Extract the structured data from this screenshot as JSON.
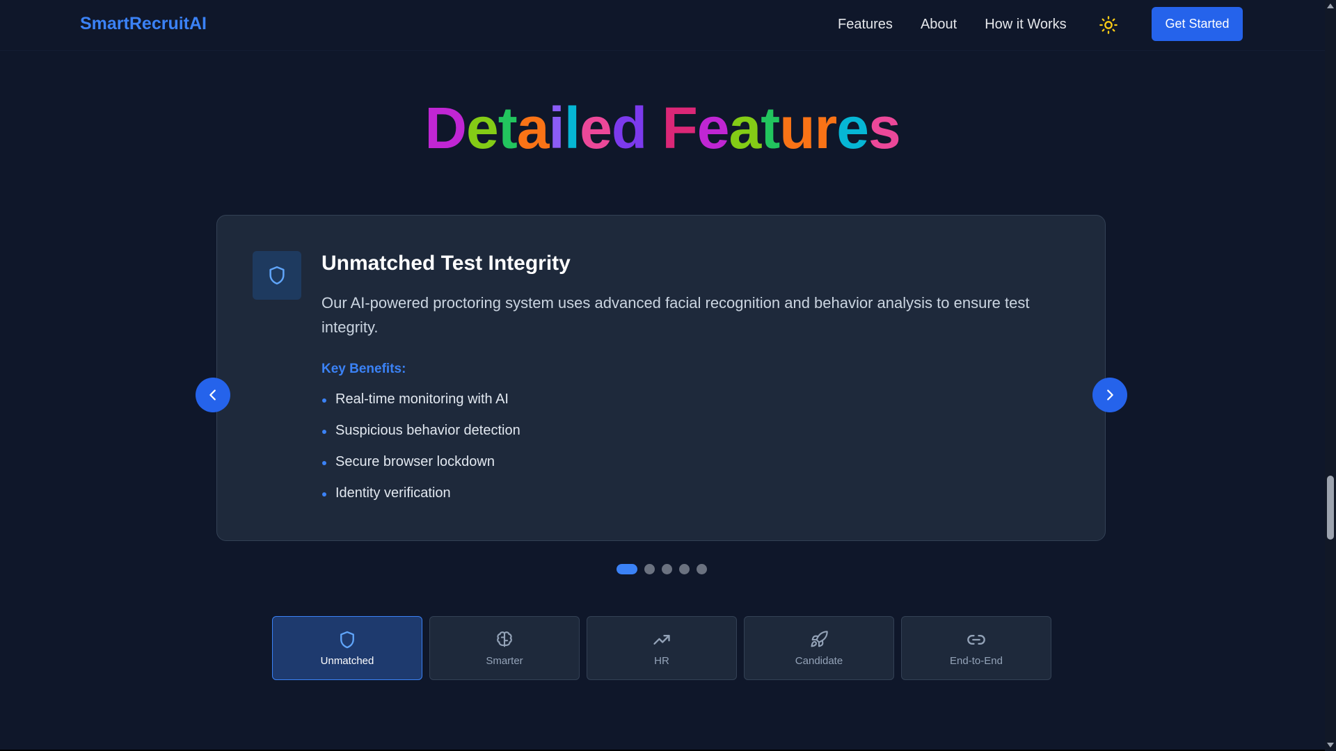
{
  "header": {
    "brand": "SmartRecruitAI",
    "nav": [
      "Features",
      "About",
      "How it Works"
    ],
    "theme_icon": "sun-icon",
    "cta_label": "Get Started"
  },
  "section": {
    "title_letters": [
      {
        "ch": "D",
        "color": "#c026d3"
      },
      {
        "ch": "e",
        "color": "#84cc16"
      },
      {
        "ch": "t",
        "color": "#22c55e"
      },
      {
        "ch": "a",
        "color": "#f97316"
      },
      {
        "ch": "i",
        "color": "#8b5cf6"
      },
      {
        "ch": "l",
        "color": "#06b6d4"
      },
      {
        "ch": "e",
        "color": "#ec4899"
      },
      {
        "ch": "d",
        "color": "#7c3aed"
      },
      {
        "ch": " ",
        "color": "#ffffff"
      },
      {
        "ch": "F",
        "color": "#db2777"
      },
      {
        "ch": "e",
        "color": "#c026d3"
      },
      {
        "ch": "a",
        "color": "#84cc16"
      },
      {
        "ch": "t",
        "color": "#22c55e"
      },
      {
        "ch": "u",
        "color": "#f97316"
      },
      {
        "ch": "r",
        "color": "#f97316"
      },
      {
        "ch": "e",
        "color": "#06b6d4"
      },
      {
        "ch": "s",
        "color": "#ec4899"
      }
    ]
  },
  "card": {
    "icon": "shield-icon",
    "title": "Unmatched Test Integrity",
    "description": "Our AI-powered proctoring system uses advanced facial recognition and behavior analysis to ensure test integrity.",
    "benefits_label": "Key Benefits:",
    "benefits": [
      "Real-time monitoring with AI",
      "Suspicious behavior detection",
      "Secure browser lockdown",
      "Identity verification"
    ]
  },
  "carousel": {
    "total_slides": 5,
    "active_index": 0
  },
  "tabs": [
    {
      "label": "Unmatched",
      "icon": "shield-icon",
      "active": true
    },
    {
      "label": "Smarter",
      "icon": "brain-icon",
      "active": false
    },
    {
      "label": "HR",
      "icon": "trending-up-icon",
      "active": false
    },
    {
      "label": "Candidate",
      "icon": "rocket-icon",
      "active": false
    },
    {
      "label": "End-to-End",
      "icon": "link-icon",
      "active": false
    }
  ],
  "colors": {
    "accent": "#2563eb",
    "background": "#0f172a",
    "card": "#1e293b",
    "benefit_label": "#3b82f6"
  }
}
